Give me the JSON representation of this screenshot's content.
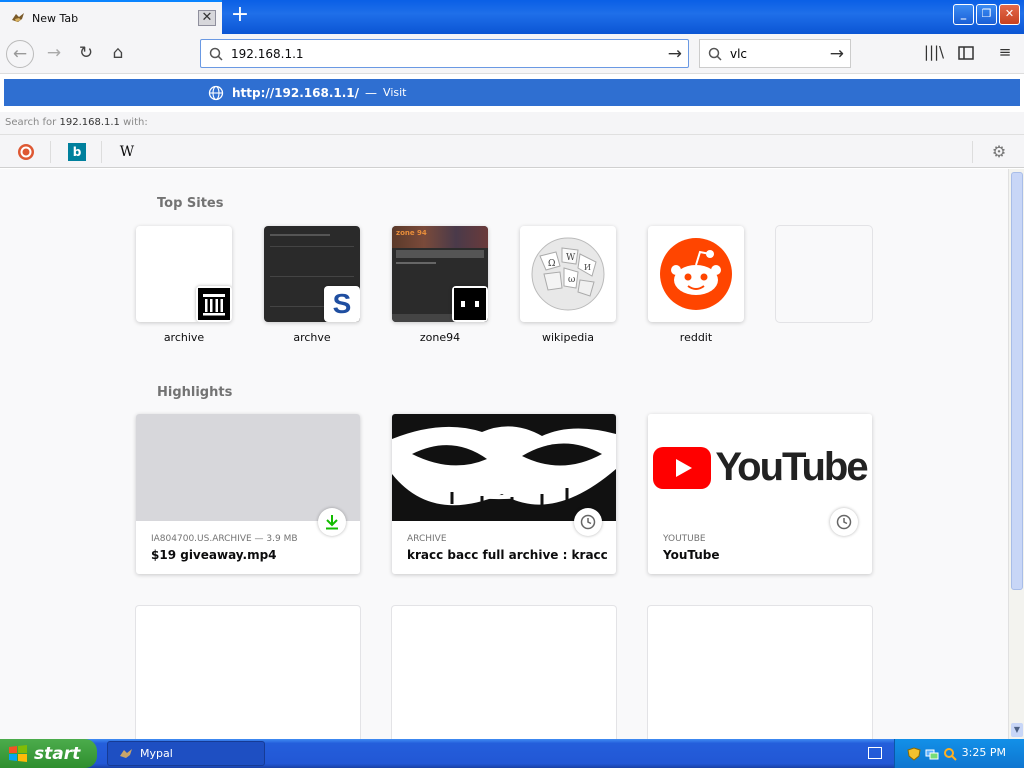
{
  "browser": {
    "tab": {
      "title": "New Tab",
      "close_label": "✕"
    },
    "new_tab_label": "+",
    "window_controls": {
      "minimize": "_",
      "restore": "❐",
      "close": "✕"
    },
    "url_value": "192.168.1.1",
    "search_value": "vlc",
    "autocomplete": {
      "url": "http://192.168.1.1/",
      "separator": "—",
      "action": "Visit",
      "search_for_prefix": "Search for",
      "search_for_query": "192.168.1.1",
      "search_for_suffix": "with:",
      "engines": [
        {
          "name": "duckduckgo-icon",
          "glyph": "D"
        },
        {
          "name": "bing-icon",
          "glyph": "b"
        },
        {
          "name": "wikipedia-icon",
          "glyph": "W"
        }
      ]
    }
  },
  "newtab": {
    "top_sites_title": "Top Sites",
    "top_sites": [
      {
        "label": "archive"
      },
      {
        "label": "archve"
      },
      {
        "label": "zone94"
      },
      {
        "label": "wikipedia"
      },
      {
        "label": "reddit"
      },
      {
        "label": ""
      }
    ],
    "highlights_title": "Highlights",
    "highlights": [
      {
        "context": "IA804700.US.ARCHIVE — 3.9 MB",
        "title": "$19 giveaway.mp4"
      },
      {
        "context": "ARCHIVE",
        "title": "kracc bacc full archive : kracc ba..."
      },
      {
        "context": "YOUTUBE",
        "title": "YouTube"
      }
    ],
    "youtube_logo_text": "YouTube",
    "zone94_logo_text": "zone 94"
  },
  "taskbar": {
    "start_label": "start",
    "task_label": "Mypal",
    "clock": "3:25 PM"
  },
  "colors": {
    "xp_blue": "#245edb",
    "autocomplete_highlight": "#2f6fd1",
    "reddit_orange": "#ff4500",
    "youtube_red": "#ff0000",
    "download_green": "#12bc00"
  }
}
